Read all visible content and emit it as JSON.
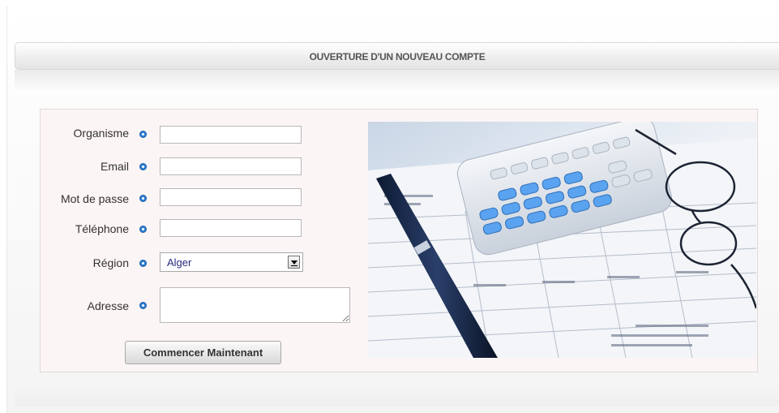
{
  "header": {
    "title": "OUVERTURE D'UN NOUVEAU COMPTE"
  },
  "form": {
    "fields": [
      {
        "label": "Organisme",
        "value": ""
      },
      {
        "label": "Email",
        "value": ""
      },
      {
        "label": "Mot de passe",
        "value": ""
      },
      {
        "label": "Téléphone",
        "value": ""
      },
      {
        "label": "Région",
        "value": "Alger"
      },
      {
        "label": "Adresse",
        "value": ""
      }
    ],
    "submit_label": "Commencer Maintenant"
  },
  "colors": {
    "panel_background": "#fcf5f5",
    "bullet": "#2f7fd4",
    "select_text": "#2a2a80"
  },
  "icons": [
    "bullet-icon",
    "dropdown-arrow-icon"
  ]
}
